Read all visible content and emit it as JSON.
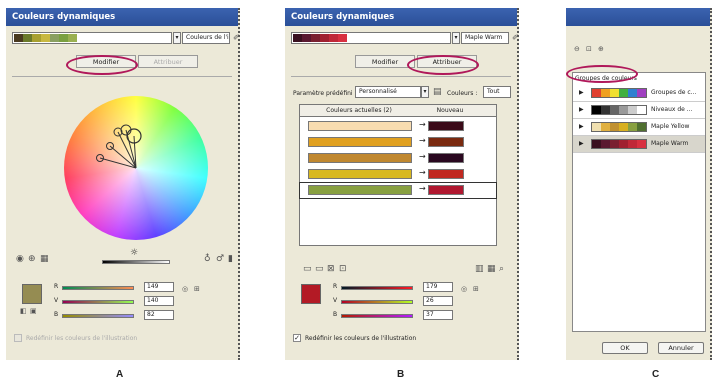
{
  "panel_a": {
    "title": "Couleurs dynamiques",
    "group_name": "Couleurs de l'illus",
    "tab_edit": "Modifier",
    "tab_assign": "Attribuer",
    "swatches": [
      "#4a3a20",
      "#6b7a2a",
      "#a8a030",
      "#c8b840",
      "#8aa060",
      "#7aa040",
      "#9ab050"
    ],
    "brightness_marker": "☼",
    "rgb": {
      "r_label": "R",
      "g_label": "V",
      "b_label": "B",
      "r": "149",
      "g": "140",
      "b": "82"
    },
    "active_color": "#958c52",
    "recolor_label": "Redéfinir les couleurs de l'illustration",
    "caption": "A"
  },
  "panel_b": {
    "title": "Couleurs dynamiques",
    "group_name": "Maple Warm",
    "tab_edit": "Modifier",
    "tab_assign": "Attribuer",
    "swatches": [
      "#3a1020",
      "#5a1830",
      "#7a2030",
      "#a02030",
      "#c02838",
      "#d83040"
    ],
    "preset_label": "Paramètre prédéfini :",
    "preset_value": "Personnalisé",
    "colors_label": "Couleurs :",
    "colors_value": "Tout",
    "col_current": "Couleurs actuelles (2)",
    "col_new": "Nouveau",
    "rows": [
      {
        "current": "#f8dcb0",
        "new": "#3a0a18"
      },
      {
        "current": "#e0a020",
        "new": "#7a2a10"
      },
      {
        "current": "#c08830",
        "new": "#2a0820"
      },
      {
        "current": "#d8b820",
        "new": "#c02820"
      },
      {
        "current": "#88a040",
        "new": "#b01830"
      }
    ],
    "arrow": "→",
    "rgb": {
      "r_label": "R",
      "g_label": "V",
      "b_label": "B",
      "r": "179",
      "g": "26",
      "b": "37"
    },
    "active_color": "#b31a25",
    "recolor_label": "Redéfinir les couleurs de l'illustration",
    "caption": "B"
  },
  "panel_c": {
    "groups_header": "Groupes de couleurs",
    "groups": [
      {
        "label": "Groupes de c...",
        "colors": [
          "#e04030",
          "#f0a020",
          "#f0e030",
          "#40b040",
          "#3080d0",
          "#a040c0"
        ]
      },
      {
        "label": "Niveaux de ...",
        "colors": [
          "#000000",
          "#333333",
          "#666666",
          "#999999",
          "#cccccc",
          "#ffffff"
        ]
      },
      {
        "label": "Maple Yellow",
        "colors": [
          "#f0e0b0",
          "#e0b040",
          "#c09030",
          "#d8b020",
          "#88a040",
          "#507030"
        ]
      },
      {
        "label": "Maple Warm",
        "colors": [
          "#3a1020",
          "#5a1830",
          "#7a2030",
          "#a02030",
          "#c02838",
          "#d83040"
        ]
      }
    ],
    "expand_glyph": "▶",
    "ok_label": "OK",
    "cancel_label": "Annuler",
    "caption": "C"
  }
}
